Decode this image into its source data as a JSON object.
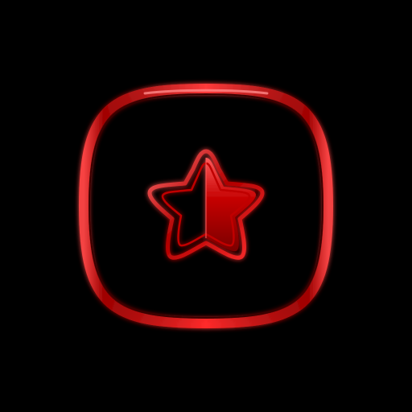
{
  "icon": {
    "name": "star-half-icon",
    "background": "#000000",
    "accent": "#e21b1b",
    "accent_dark": "#6a0000",
    "highlight": "#ff6b6b"
  }
}
